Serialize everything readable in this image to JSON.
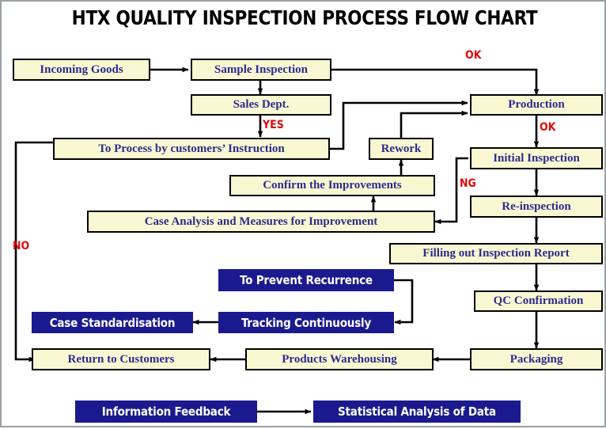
{
  "title": "HTX QUALITY INSPECTION PROCESS FLOW CHART",
  "colors": {
    "box_fill": "#FAF8D2",
    "box_border": "#000000",
    "box_text": "#2B2B8F",
    "navy_fill": "#1A1A8E",
    "navy_text": "#FFFFFF",
    "label_red": "#DD0B0B",
    "connector": "#000000",
    "background": "#FFFFFF"
  },
  "nodes": {
    "incoming_goods": "Incoming Goods",
    "sample_inspection": "Sample Inspection",
    "sales_dept": "Sales Dept.",
    "to_process": "To Process by customers’ Instruction",
    "production": "Production",
    "rework": "Rework",
    "initial_inspection": "Initial Inspection",
    "confirm_improvements": "Confirm the Improvements",
    "re_inspection": "Re-inspection",
    "case_analysis": "Case Analysis and Measures for Improvement",
    "filling_report": "Filling out Inspection Report",
    "prevent_recurrence": "To Prevent Recurrence",
    "qc_confirmation": "QC Confirmation",
    "case_standardisation": "Case Standardisation",
    "tracking_continuously": "Tracking Continuously",
    "return_customers": "Return to Customers",
    "products_warehousing": "Products Warehousing",
    "packaging": "Packaging",
    "information_feedback": "Information Feedback",
    "statistical_analysis": "Statistical Analysis of Data"
  },
  "edge_labels": {
    "ok_top": "OK",
    "yes": "YES",
    "ok_production": "OK",
    "ng": "NG",
    "no": "NO"
  },
  "chart_data": {
    "type": "diagram",
    "diagram_kind": "process-flow-chart",
    "title": "HTX QUALITY INSPECTION PROCESS FLOW CHART",
    "node_list": [
      {
        "id": "incoming_goods",
        "label": "Incoming Goods",
        "style": "yellow"
      },
      {
        "id": "sample_inspection",
        "label": "Sample Inspection",
        "style": "yellow"
      },
      {
        "id": "sales_dept",
        "label": "Sales Dept.",
        "style": "yellow"
      },
      {
        "id": "to_process",
        "label": "To Process by customers’ Instruction",
        "style": "yellow"
      },
      {
        "id": "production",
        "label": "Production",
        "style": "yellow"
      },
      {
        "id": "rework",
        "label": "Rework",
        "style": "yellow"
      },
      {
        "id": "initial_inspection",
        "label": "Initial Inspection",
        "style": "yellow"
      },
      {
        "id": "confirm_improvements",
        "label": "Confirm the Improvements",
        "style": "yellow"
      },
      {
        "id": "re_inspection",
        "label": "Re-inspection",
        "style": "yellow"
      },
      {
        "id": "case_analysis",
        "label": "Case Analysis and Measures for Improvement",
        "style": "yellow"
      },
      {
        "id": "filling_report",
        "label": "Filling out Inspection Report",
        "style": "yellow"
      },
      {
        "id": "prevent_recurrence",
        "label": "To Prevent Recurrence",
        "style": "navy"
      },
      {
        "id": "qc_confirmation",
        "label": "QC Confirmation",
        "style": "yellow"
      },
      {
        "id": "case_standardisation",
        "label": "Case Standardisation",
        "style": "navy"
      },
      {
        "id": "tracking_continuously",
        "label": "Tracking Continuously",
        "style": "navy"
      },
      {
        "id": "return_customers",
        "label": "Return to Customers",
        "style": "yellow"
      },
      {
        "id": "products_warehousing",
        "label": "Products Warehousing",
        "style": "yellow"
      },
      {
        "id": "packaging",
        "label": "Packaging",
        "style": "yellow"
      },
      {
        "id": "information_feedback",
        "label": "Information Feedback",
        "style": "navy"
      },
      {
        "id": "statistical_analysis",
        "label": "Statistical Analysis of Data",
        "style": "navy"
      }
    ],
    "edges": [
      {
        "from": "incoming_goods",
        "to": "sample_inspection",
        "label": ""
      },
      {
        "from": "sample_inspection",
        "to": "production",
        "label": "OK"
      },
      {
        "from": "sample_inspection",
        "to": "sales_dept",
        "label": ""
      },
      {
        "from": "sales_dept",
        "to": "to_process",
        "label": "YES"
      },
      {
        "from": "to_process",
        "to": "production",
        "label": ""
      },
      {
        "from": "to_process",
        "to": "return_customers",
        "label": "NO"
      },
      {
        "from": "production",
        "to": "initial_inspection",
        "label": "OK"
      },
      {
        "from": "initial_inspection",
        "to": "case_analysis",
        "label": "NG"
      },
      {
        "from": "initial_inspection",
        "to": "re_inspection",
        "label": ""
      },
      {
        "from": "case_analysis",
        "to": "confirm_improvements",
        "label": ""
      },
      {
        "from": "confirm_improvements",
        "to": "rework",
        "label": ""
      },
      {
        "from": "rework",
        "to": "production",
        "label": ""
      },
      {
        "from": "re_inspection",
        "to": "filling_report",
        "label": ""
      },
      {
        "from": "filling_report",
        "to": "qc_confirmation",
        "label": ""
      },
      {
        "from": "qc_confirmation",
        "to": "packaging",
        "label": ""
      },
      {
        "from": "packaging",
        "to": "products_warehousing",
        "label": ""
      },
      {
        "from": "products_warehousing",
        "to": "return_customers",
        "label": ""
      },
      {
        "from": "prevent_recurrence",
        "to": "tracking_continuously",
        "label": ""
      },
      {
        "from": "tracking_continuously",
        "to": "case_standardisation",
        "label": ""
      },
      {
        "from": "information_feedback",
        "to": "statistical_analysis",
        "label": ""
      }
    ]
  }
}
